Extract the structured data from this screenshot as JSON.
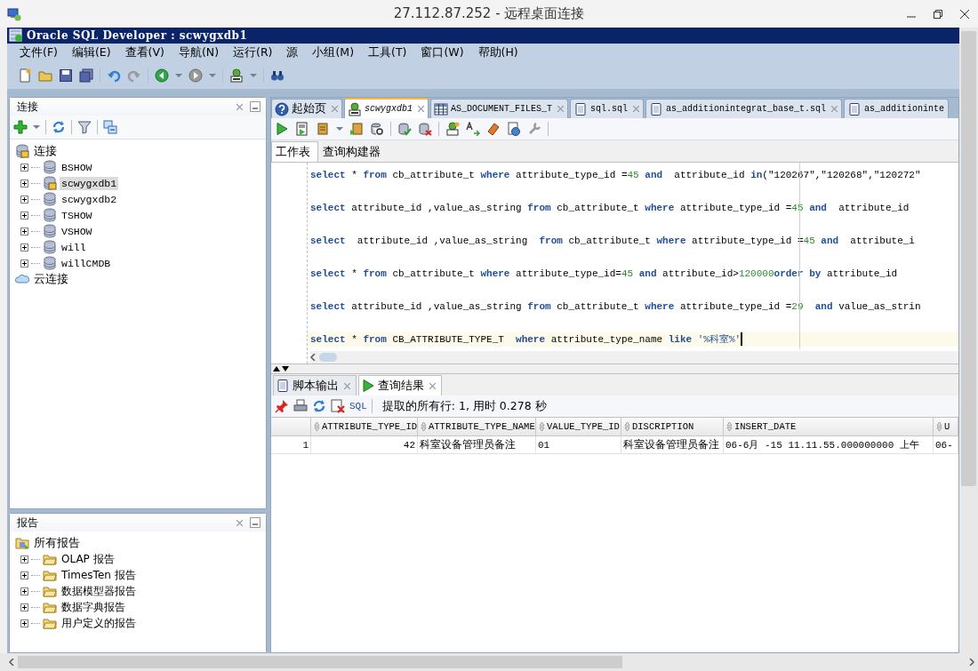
{
  "remote_window": {
    "title": "27.112.87.252 - 远程桌面连接"
  },
  "app": {
    "title": "Oracle SQL Developer : scwygxdb1"
  },
  "menu": [
    "文件(F)",
    "编辑(E)",
    "查看(V)",
    "导航(N)",
    "运行(R)",
    "源",
    "小组(M)",
    "工具(T)",
    "窗口(W)",
    "帮助(H)"
  ],
  "connections_panel": {
    "title": "连接",
    "root": {
      "label": "连接",
      "children": [
        {
          "label": "BSHOW",
          "kind": "db",
          "selected": false,
          "expanded": false
        },
        {
          "label": "scwygxdb1",
          "kind": "db_connected",
          "selected": true,
          "expanded": false
        },
        {
          "label": "scwygxdb2",
          "kind": "db",
          "selected": false,
          "expanded": false
        },
        {
          "label": "TSHOW",
          "kind": "db",
          "selected": false,
          "expanded": false
        },
        {
          "label": "VSHOW",
          "kind": "db",
          "selected": false,
          "expanded": false
        },
        {
          "label": "will",
          "kind": "db",
          "selected": false,
          "expanded": false
        },
        {
          "label": "willCMDB",
          "kind": "db",
          "selected": false,
          "expanded": false
        }
      ]
    },
    "cloud": {
      "label": "云连接"
    }
  },
  "reports_panel": {
    "title": "报告",
    "root": {
      "label": "所有报告",
      "children": [
        {
          "label": "OLAP 报告",
          "expanded": false
        },
        {
          "label": "TimesTen 报告",
          "expanded": false
        },
        {
          "label": "数据模型器报告",
          "expanded": false
        },
        {
          "label": "数据字典报告",
          "expanded": false
        },
        {
          "label": "用户定义的报告",
          "expanded": false
        }
      ]
    }
  },
  "editor_tabs": [
    {
      "label": "起始页",
      "kind": "help",
      "selected": false,
      "closable": true
    },
    {
      "label": "scwygxdb1",
      "kind": "sql_worksheet",
      "selected": true,
      "closable": true
    },
    {
      "label": "AS_DOCUMENT_FILES_T",
      "kind": "table",
      "selected": false,
      "closable": true
    },
    {
      "label": "sql.sql",
      "kind": "file",
      "selected": false,
      "closable": true
    },
    {
      "label": "as_additionintegrat_base_t.sql",
      "kind": "file",
      "selected": false,
      "closable": true
    },
    {
      "label": "as_additioninte",
      "kind": "file",
      "selected": false,
      "closable": false
    }
  ],
  "sub_tabs": [
    {
      "label": "工作表",
      "selected": true
    },
    {
      "label": "查询构建器",
      "selected": false
    }
  ],
  "code_lines": [
    {
      "current": false,
      "tokens": [
        {
          "kind": "kw",
          "text": "select"
        },
        {
          "kind": "plain",
          "text": " * "
        },
        {
          "kind": "kw",
          "text": "from"
        },
        {
          "kind": "plain",
          "text": " cb_attribute_t "
        },
        {
          "kind": "kw",
          "text": "where"
        },
        {
          "kind": "plain",
          "text": " attribute_type_id ="
        },
        {
          "kind": "num",
          "text": "45"
        },
        {
          "kind": "kw",
          "text": " and"
        },
        {
          "kind": "plain",
          "text": "  attribute_id "
        },
        {
          "kind": "kw",
          "text": "in"
        },
        {
          "kind": "plain",
          "text": "(\"120267\",\"120268\",\"120272\""
        }
      ]
    },
    {
      "current": false,
      "tokens": [
        {
          "kind": "kw",
          "text": "select"
        },
        {
          "kind": "plain",
          "text": " attribute_id ,value_as_string "
        },
        {
          "kind": "kw",
          "text": "from"
        },
        {
          "kind": "plain",
          "text": " cb_attribute_t "
        },
        {
          "kind": "kw",
          "text": "where"
        },
        {
          "kind": "plain",
          "text": " attribute_type_id ="
        },
        {
          "kind": "num",
          "text": "45"
        },
        {
          "kind": "kw",
          "text": " and"
        },
        {
          "kind": "plain",
          "text": "  attribute_id"
        }
      ]
    },
    {
      "current": false,
      "tokens": [
        {
          "kind": "kw",
          "text": "select"
        },
        {
          "kind": "plain",
          "text": "  attribute_id ,value_as_string  "
        },
        {
          "kind": "kw",
          "text": "from"
        },
        {
          "kind": "plain",
          "text": " cb_attribute_t "
        },
        {
          "kind": "kw",
          "text": "where"
        },
        {
          "kind": "plain",
          "text": " attribute_type_id ="
        },
        {
          "kind": "num",
          "text": "45"
        },
        {
          "kind": "kw",
          "text": " and"
        },
        {
          "kind": "plain",
          "text": "  attribute_i"
        }
      ]
    },
    {
      "current": false,
      "tokens": [
        {
          "kind": "kw",
          "text": "select"
        },
        {
          "kind": "plain",
          "text": " * "
        },
        {
          "kind": "kw",
          "text": "from"
        },
        {
          "kind": "plain",
          "text": " cb_attribute_t "
        },
        {
          "kind": "kw",
          "text": "where"
        },
        {
          "kind": "plain",
          "text": " attribute_type_id="
        },
        {
          "kind": "num",
          "text": "45"
        },
        {
          "kind": "kw",
          "text": " and"
        },
        {
          "kind": "plain",
          "text": " attribute_id>"
        },
        {
          "kind": "num",
          "text": "120000"
        },
        {
          "kind": "kw",
          "text": "order by"
        },
        {
          "kind": "plain",
          "text": " attribute_id"
        }
      ]
    },
    {
      "current": false,
      "tokens": [
        {
          "kind": "kw",
          "text": "select"
        },
        {
          "kind": "plain",
          "text": " attribute_id ,value_as_string "
        },
        {
          "kind": "kw",
          "text": "from"
        },
        {
          "kind": "plain",
          "text": " cb_attribute_t "
        },
        {
          "kind": "kw",
          "text": "where"
        },
        {
          "kind": "plain",
          "text": " attribute_type_id ="
        },
        {
          "kind": "num",
          "text": "29"
        },
        {
          "kind": "kw",
          "text": "  and"
        },
        {
          "kind": "plain",
          "text": " value_as_strin"
        }
      ]
    },
    {
      "current": true,
      "tokens": [
        {
          "kind": "kw",
          "text": "select"
        },
        {
          "kind": "plain",
          "text": " * "
        },
        {
          "kind": "kw",
          "text": "from"
        },
        {
          "kind": "plain",
          "text": " CB_ATTRIBUTE_TYPE_T  "
        },
        {
          "kind": "kw",
          "text": "where"
        },
        {
          "kind": "plain",
          "text": " attribute_type_name "
        },
        {
          "kind": "kw",
          "text": "like"
        },
        {
          "kind": "str",
          "text": " '%科室%'"
        }
      ]
    }
  ],
  "result_tabs": [
    {
      "label": "脚本输出",
      "kind": "script",
      "selected": false
    },
    {
      "label": "查询结果",
      "kind": "run",
      "selected": true
    }
  ],
  "result_toolbar": {
    "sql_button": "SQL",
    "status": "提取的所有行: 1, 用时 0.278 秒"
  },
  "grid": {
    "columns": [
      "ATTRIBUTE_TYPE_ID",
      "ATTRIBUTE_TYPE_NAME",
      "VALUE_TYPE_ID",
      "DISCRIPTION",
      "INSERT_DATE",
      "U"
    ],
    "rows": [
      {
        "number": "1",
        "cells": [
          "42",
          "科室设备管理员备注",
          "01",
          "科室设备管理员备注",
          "06-6月 -15 11.11.55.000000000 上午",
          "06-"
        ]
      }
    ]
  }
}
